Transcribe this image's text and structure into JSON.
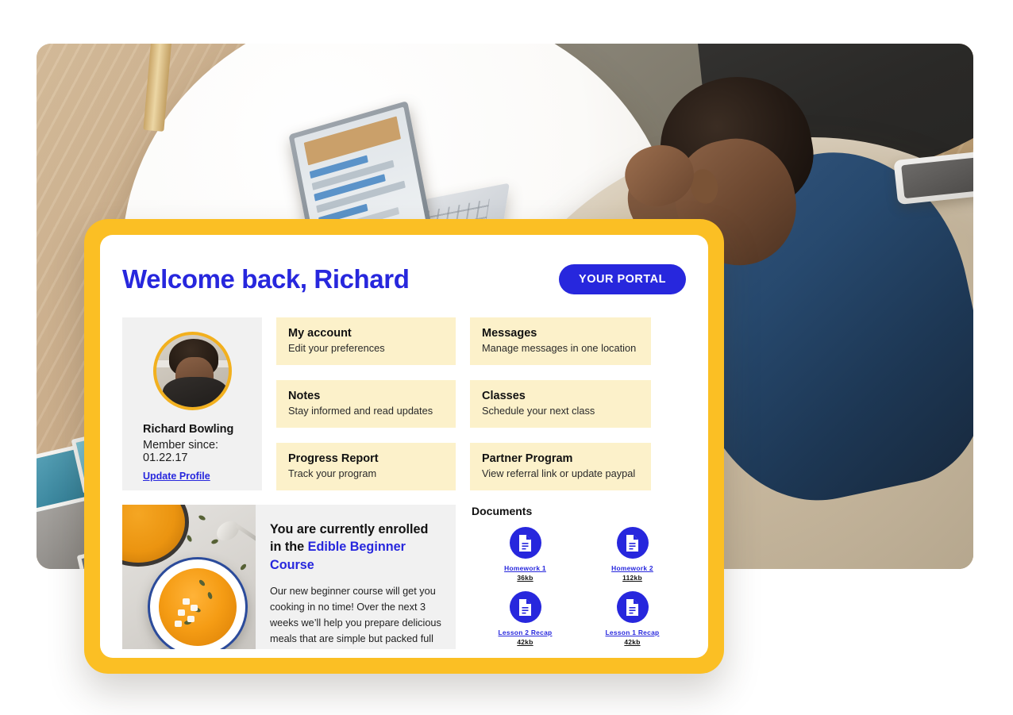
{
  "header": {
    "welcome_title": "Welcome back, Richard",
    "portal_button": "YOUR PORTAL"
  },
  "profile": {
    "avatar_alt": "avatar",
    "name": "Richard Bowling",
    "member_since": "Member since: 01.22.17",
    "update_link": "Update Profile"
  },
  "tiles_left": [
    {
      "title": "My account",
      "subtitle": "Edit your preferences"
    },
    {
      "title": "Notes",
      "subtitle": "Stay informed and read updates"
    },
    {
      "title": "Progress Report",
      "subtitle": "Track your program"
    }
  ],
  "tiles_right": [
    {
      "title": "Messages",
      "subtitle": "Manage messages in one location"
    },
    {
      "title": "Classes",
      "subtitle": "Schedule your next class"
    },
    {
      "title": "Partner Program",
      "subtitle": "View referral link or update paypal"
    }
  ],
  "course": {
    "heading_prefix": "You are currently enrolled in the ",
    "course_name": "Edible Beginner Course",
    "body": "Our new beginner course will get you cooking in no time! Over the next 3 weeks we’ll help you prepare delicious meals that are simple but packed full of flavor and fun. Track your progress here in the portal daily. Bon appetite!",
    "photo_alt": "bowl-of-soup-photo"
  },
  "documents": {
    "title": "Documents",
    "items": [
      {
        "name": "Homework 1",
        "size": "36kb"
      },
      {
        "name": "Homework 2",
        "size": "112kb"
      },
      {
        "name": "Lesson 2 Recap",
        "size": "42kb"
      },
      {
        "name": "Lesson 1 Recap",
        "size": "42kb"
      }
    ]
  },
  "colors": {
    "brand_blue": "#2727dd",
    "frame_yellow": "#fbbf24",
    "tile_cream": "#fcf1ca",
    "card_gray": "#f1f1f1"
  }
}
